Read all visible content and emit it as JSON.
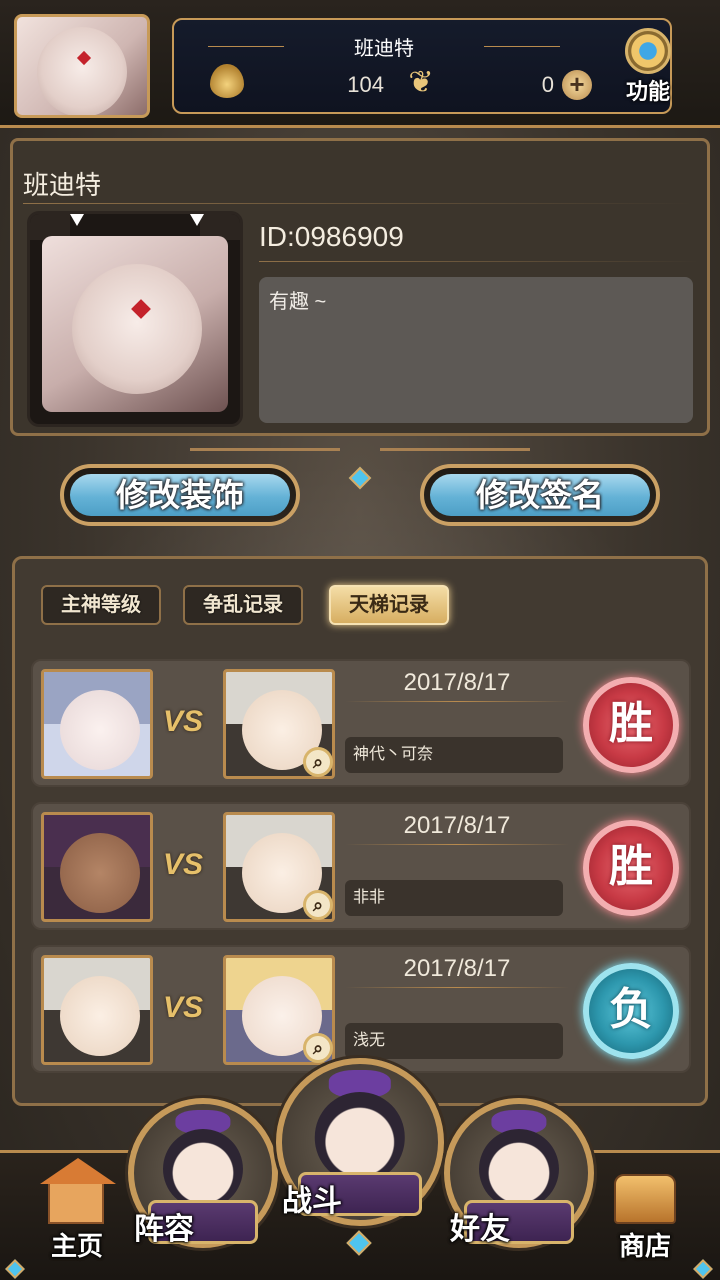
{
  "header": {
    "player_name": "班迪特",
    "currency_amount": "104",
    "gem_amount": "0",
    "function_label": "功能",
    "icons": {
      "currency": "flame-coin-icon",
      "butterfly": "butterfly-icon",
      "plus": "plus-icon",
      "function": "gear-icon"
    }
  },
  "profile": {
    "name": "班迪特",
    "user_id": "ID:0986909",
    "signature": "有趣 ~"
  },
  "actions": {
    "edit_decoration": "修改装饰",
    "edit_signature": "修改签名"
  },
  "record_tabs": [
    {
      "label": "主神等级",
      "active": false
    },
    {
      "label": "争乱记录",
      "active": false
    },
    {
      "label": "天梯记录",
      "active": true
    }
  ],
  "matches": [
    {
      "date": "2017/8/17",
      "opponent": "神代丶可奈",
      "result": "胜",
      "vs": "VS"
    },
    {
      "date": "2017/8/17",
      "opponent": "非非",
      "result": "胜",
      "vs": "VS"
    },
    {
      "date": "2017/8/17",
      "opponent": "浅无",
      "result": "负",
      "vs": "VS"
    }
  ],
  "nav": {
    "home": "主页",
    "team": "阵容",
    "battle": "战斗",
    "friends": "好友",
    "shop": "商店"
  },
  "colors": {
    "accent_gold": "#c79a58",
    "win_red": "#c83a45",
    "lose_teal": "#2d97ad",
    "button_blue": "#64b2d6"
  }
}
